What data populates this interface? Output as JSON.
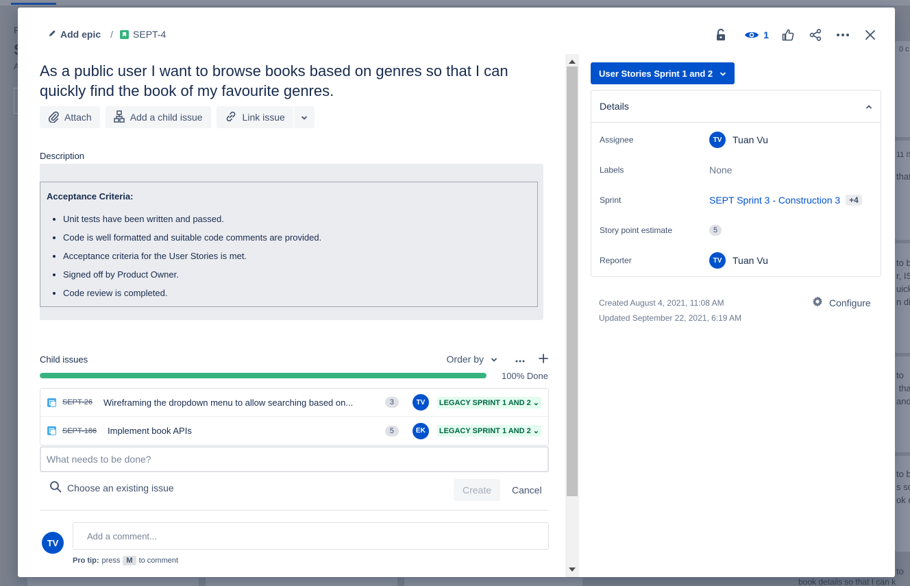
{
  "background": {
    "left_text_a": "P",
    "left_text_b": "S",
    "left_text_c": "A",
    "right_text_1": "0 c",
    "right_text_2": "11 IS",
    "right_text_3": "that",
    "right_text_4": "to b\nr, IS\nuick\nn dif",
    "right_text_5": "to\n tha\nand g",
    "right_text_6": "to b\ns so\nok c",
    "right_text_7": "to",
    "bottom_text": "book details so that I can k"
  },
  "breadcrumb": {
    "add_epic": "Add epic",
    "separator": "/",
    "issue_key": "SEPT-4"
  },
  "top_actions": {
    "watch_count": "1"
  },
  "issue": {
    "title": "As a public user I want to browse books based on genres so that I can quickly find the book of my favourite genres."
  },
  "toolbar": {
    "attach": "Attach",
    "add_child": "Add a child issue",
    "link_issue": "Link issue"
  },
  "description": {
    "label": "Description",
    "heading": "Acceptance Criteria:",
    "items": [
      "Unit tests have been written and passed.",
      "Code is well formatted and suitable code comments are provided.",
      "Acceptance criteria for the User Stories is met.",
      "Signed off by Product Owner.",
      "Code review is completed."
    ]
  },
  "child_issues": {
    "label": "Child issues",
    "order_by": "Order by",
    "progress_percent": 100,
    "progress_text": "100% Done",
    "rows": [
      {
        "key": "SEPT-26",
        "summary": "Wireframing the dropdown menu to allow searching based on...",
        "points": "3",
        "assignee": "TV",
        "status": "LEGACY SPRINT 1 AND 2"
      },
      {
        "key": "SEPT-186",
        "summary": "Implement book APIs",
        "points": "5",
        "assignee": "EK",
        "status": "LEGACY SPRINT 1 AND 2"
      }
    ],
    "new_placeholder": "What needs to be done?",
    "choose_existing": "Choose an existing issue",
    "create": "Create",
    "cancel": "Cancel"
  },
  "comment": {
    "avatar": "TV",
    "placeholder": "Add a comment...",
    "protip_label": "Pro tip:",
    "protip_press": "press",
    "protip_key": "M",
    "protip_rest": "to comment"
  },
  "right_panel": {
    "status_button": "User Stories Sprint 1 and 2",
    "details_title": "Details",
    "assignee_label": "Assignee",
    "assignee_initials": "TV",
    "assignee_name": "Tuan Vu",
    "labels_label": "Labels",
    "labels_value": "None",
    "sprint_label": "Sprint",
    "sprint_value": "SEPT Sprint 3 - Construction 3",
    "sprint_more": "+4",
    "points_label": "Story point estimate",
    "points_value": "5",
    "reporter_label": "Reporter",
    "reporter_initials": "TV",
    "reporter_name": "Tuan Vu",
    "created": "Created August 4, 2021, 11:08 AM",
    "updated": "Updated September 22, 2021, 6:19 AM",
    "configure": "Configure"
  },
  "colors": {
    "primary": "#0052cc",
    "success": "#36b37e",
    "status_bg": "#e3fcef",
    "status_text": "#006644"
  },
  "icons": [
    "pencil-icon",
    "story-icon",
    "unlock-icon",
    "eye-icon",
    "thumbs-up-icon",
    "share-icon",
    "more-icon",
    "close-icon",
    "paperclip-icon",
    "child-issue-icon",
    "link-icon",
    "chevron-down-icon",
    "plus-icon",
    "subtask-icon",
    "search-icon",
    "chevron-up-icon",
    "gear-icon"
  ]
}
